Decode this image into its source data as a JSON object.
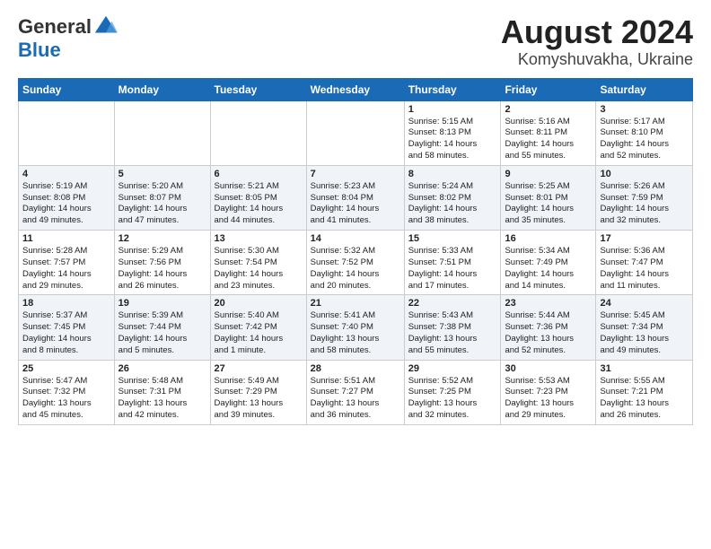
{
  "header": {
    "logo_line1": "General",
    "logo_line2": "Blue",
    "title": "August 2024",
    "subtitle": "Komyshuvakha, Ukraine"
  },
  "weekdays": [
    "Sunday",
    "Monday",
    "Tuesday",
    "Wednesday",
    "Thursday",
    "Friday",
    "Saturday"
  ],
  "weeks": [
    [
      {
        "day": "",
        "info": ""
      },
      {
        "day": "",
        "info": ""
      },
      {
        "day": "",
        "info": ""
      },
      {
        "day": "",
        "info": ""
      },
      {
        "day": "1",
        "info": "Sunrise: 5:15 AM\nSunset: 8:13 PM\nDaylight: 14 hours\nand 58 minutes."
      },
      {
        "day": "2",
        "info": "Sunrise: 5:16 AM\nSunset: 8:11 PM\nDaylight: 14 hours\nand 55 minutes."
      },
      {
        "day": "3",
        "info": "Sunrise: 5:17 AM\nSunset: 8:10 PM\nDaylight: 14 hours\nand 52 minutes."
      }
    ],
    [
      {
        "day": "4",
        "info": "Sunrise: 5:19 AM\nSunset: 8:08 PM\nDaylight: 14 hours\nand 49 minutes."
      },
      {
        "day": "5",
        "info": "Sunrise: 5:20 AM\nSunset: 8:07 PM\nDaylight: 14 hours\nand 47 minutes."
      },
      {
        "day": "6",
        "info": "Sunrise: 5:21 AM\nSunset: 8:05 PM\nDaylight: 14 hours\nand 44 minutes."
      },
      {
        "day": "7",
        "info": "Sunrise: 5:23 AM\nSunset: 8:04 PM\nDaylight: 14 hours\nand 41 minutes."
      },
      {
        "day": "8",
        "info": "Sunrise: 5:24 AM\nSunset: 8:02 PM\nDaylight: 14 hours\nand 38 minutes."
      },
      {
        "day": "9",
        "info": "Sunrise: 5:25 AM\nSunset: 8:01 PM\nDaylight: 14 hours\nand 35 minutes."
      },
      {
        "day": "10",
        "info": "Sunrise: 5:26 AM\nSunset: 7:59 PM\nDaylight: 14 hours\nand 32 minutes."
      }
    ],
    [
      {
        "day": "11",
        "info": "Sunrise: 5:28 AM\nSunset: 7:57 PM\nDaylight: 14 hours\nand 29 minutes."
      },
      {
        "day": "12",
        "info": "Sunrise: 5:29 AM\nSunset: 7:56 PM\nDaylight: 14 hours\nand 26 minutes."
      },
      {
        "day": "13",
        "info": "Sunrise: 5:30 AM\nSunset: 7:54 PM\nDaylight: 14 hours\nand 23 minutes."
      },
      {
        "day": "14",
        "info": "Sunrise: 5:32 AM\nSunset: 7:52 PM\nDaylight: 14 hours\nand 20 minutes."
      },
      {
        "day": "15",
        "info": "Sunrise: 5:33 AM\nSunset: 7:51 PM\nDaylight: 14 hours\nand 17 minutes."
      },
      {
        "day": "16",
        "info": "Sunrise: 5:34 AM\nSunset: 7:49 PM\nDaylight: 14 hours\nand 14 minutes."
      },
      {
        "day": "17",
        "info": "Sunrise: 5:36 AM\nSunset: 7:47 PM\nDaylight: 14 hours\nand 11 minutes."
      }
    ],
    [
      {
        "day": "18",
        "info": "Sunrise: 5:37 AM\nSunset: 7:45 PM\nDaylight: 14 hours\nand 8 minutes."
      },
      {
        "day": "19",
        "info": "Sunrise: 5:39 AM\nSunset: 7:44 PM\nDaylight: 14 hours\nand 5 minutes."
      },
      {
        "day": "20",
        "info": "Sunrise: 5:40 AM\nSunset: 7:42 PM\nDaylight: 14 hours\nand 1 minute."
      },
      {
        "day": "21",
        "info": "Sunrise: 5:41 AM\nSunset: 7:40 PM\nDaylight: 13 hours\nand 58 minutes."
      },
      {
        "day": "22",
        "info": "Sunrise: 5:43 AM\nSunset: 7:38 PM\nDaylight: 13 hours\nand 55 minutes."
      },
      {
        "day": "23",
        "info": "Sunrise: 5:44 AM\nSunset: 7:36 PM\nDaylight: 13 hours\nand 52 minutes."
      },
      {
        "day": "24",
        "info": "Sunrise: 5:45 AM\nSunset: 7:34 PM\nDaylight: 13 hours\nand 49 minutes."
      }
    ],
    [
      {
        "day": "25",
        "info": "Sunrise: 5:47 AM\nSunset: 7:32 PM\nDaylight: 13 hours\nand 45 minutes."
      },
      {
        "day": "26",
        "info": "Sunrise: 5:48 AM\nSunset: 7:31 PM\nDaylight: 13 hours\nand 42 minutes."
      },
      {
        "day": "27",
        "info": "Sunrise: 5:49 AM\nSunset: 7:29 PM\nDaylight: 13 hours\nand 39 minutes."
      },
      {
        "day": "28",
        "info": "Sunrise: 5:51 AM\nSunset: 7:27 PM\nDaylight: 13 hours\nand 36 minutes."
      },
      {
        "day": "29",
        "info": "Sunrise: 5:52 AM\nSunset: 7:25 PM\nDaylight: 13 hours\nand 32 minutes."
      },
      {
        "day": "30",
        "info": "Sunrise: 5:53 AM\nSunset: 7:23 PM\nDaylight: 13 hours\nand 29 minutes."
      },
      {
        "day": "31",
        "info": "Sunrise: 5:55 AM\nSunset: 7:21 PM\nDaylight: 13 hours\nand 26 minutes."
      }
    ]
  ]
}
